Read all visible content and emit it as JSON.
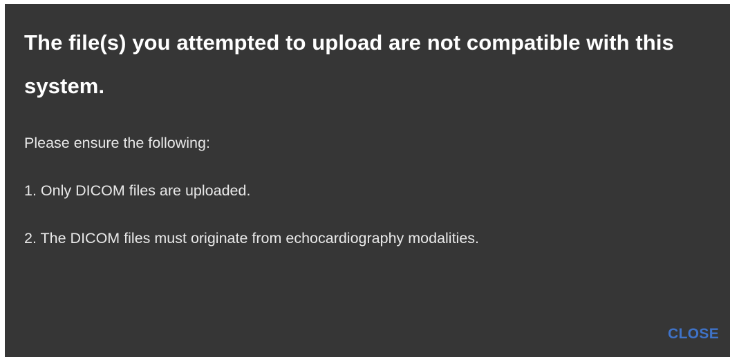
{
  "dialog": {
    "title": "The file(s) you attempted to upload are not compatible with this system.",
    "intro": "Please ensure the following:",
    "items": [
      "1. Only DICOM files are uploaded.",
      "2. The DICOM files must originate from echocardiography modalities."
    ],
    "close_label": "CLOSE"
  },
  "colors": {
    "dialog_background": "#363636",
    "text": "#ffffff",
    "accent": "#3f73c9"
  }
}
